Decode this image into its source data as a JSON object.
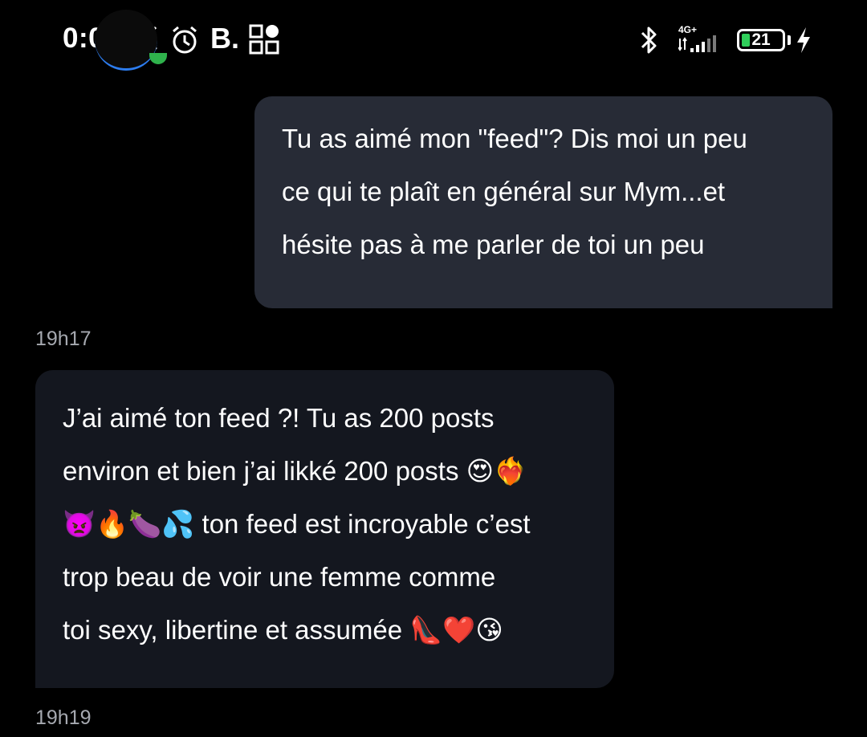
{
  "status_bar": {
    "time": "0:05",
    "carrier_mark": "B.",
    "network_type": "4G+",
    "battery_level": "21",
    "battery_fraction": 0.21,
    "battery_fill_color": "#2fcf5a",
    "charging": true,
    "icons": [
      "bell-off-icon",
      "alarm-clock-icon",
      "qr-grid-icon",
      "bluetooth-icon",
      "signal-icon",
      "battery-icon",
      "charging-bolt-icon"
    ]
  },
  "conversation": {
    "avatar_ring_color": "#2d7df0",
    "online_color": "#2fb24c",
    "messages": [
      {
        "direction": "sent",
        "bubble_color": "#272b36",
        "lines": [
          "Tu as aimé mon \"feed\"? Dis moi un peu",
          "ce qui te plaît en général sur Mym...et",
          "hésite pas à me parler de toi un peu"
        ],
        "time": "19h17"
      },
      {
        "direction": "received",
        "bubble_color": "#14171f",
        "lines": [
          "J’ai aimé ton feed ?! Tu as 200 posts",
          "environ et bien j’ai likké 200 posts 😍❤️‍🔥",
          "👿🔥🍆💦 ton feed est incroyable c’est",
          "trop beau de voir une femme comme",
          "toi sexy, libertine et assumée 👠❤️😘"
        ],
        "time": "19h19"
      }
    ]
  }
}
